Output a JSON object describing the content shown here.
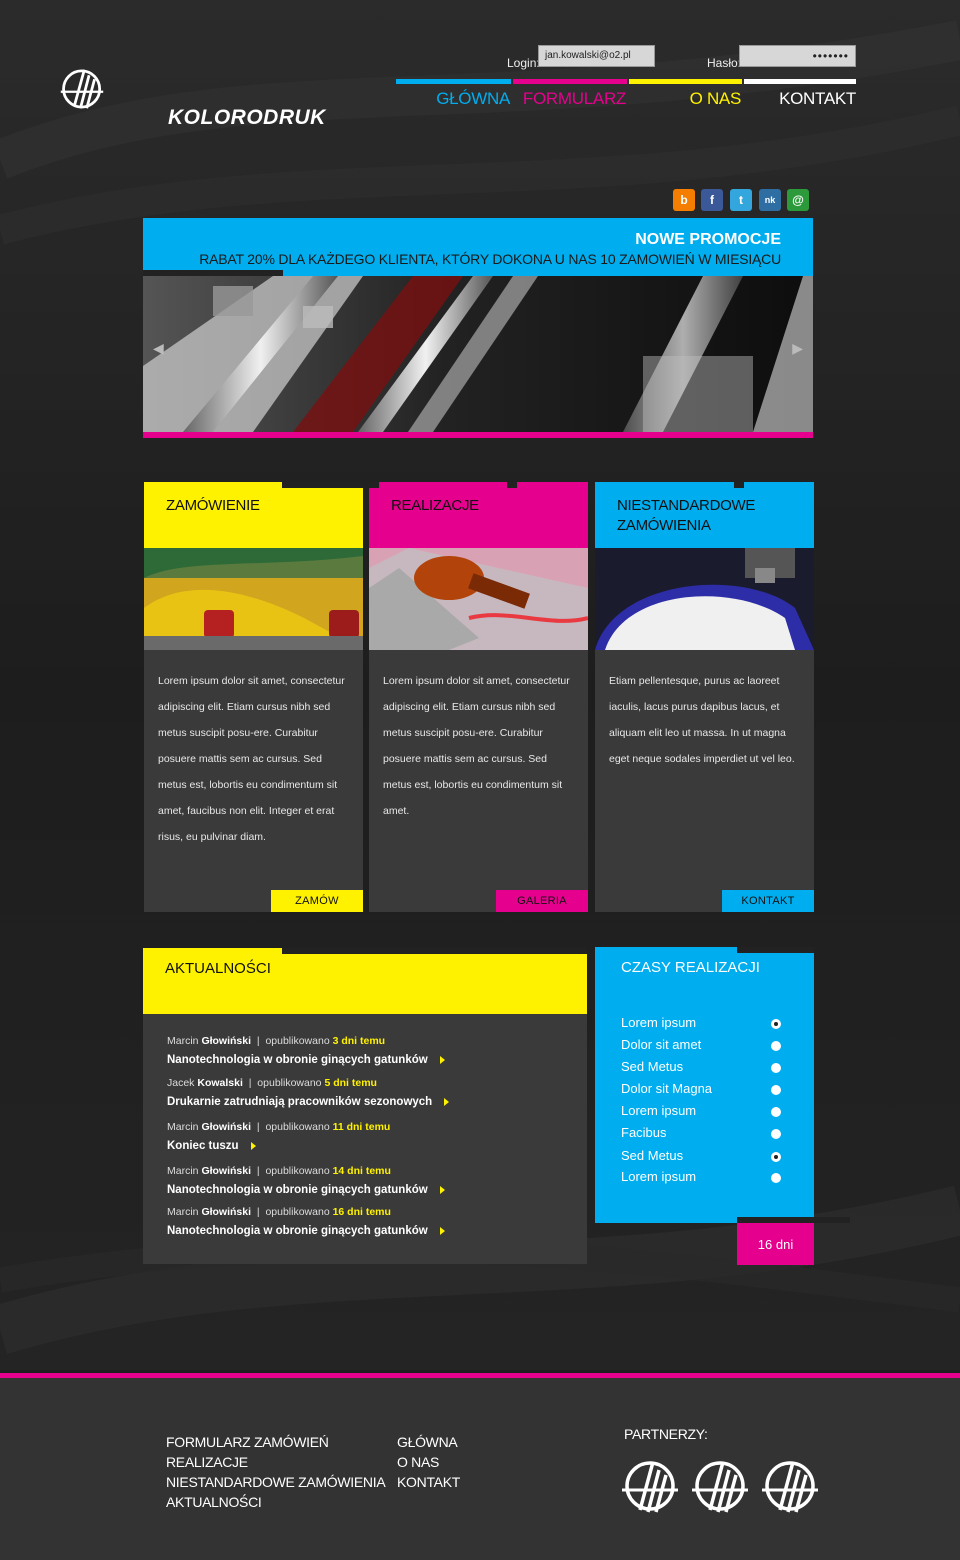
{
  "brand": {
    "name": "KOLORODRUK"
  },
  "login": {
    "login_label": "Login:",
    "login_value": "jan.kowalski@o2.pl",
    "password_label": "Hasło:",
    "password_value": "•••••••"
  },
  "nav": [
    {
      "label": "GŁÓWNA",
      "color": "#00adee"
    },
    {
      "label": "FORMULARZ",
      "color": "#e5008d"
    },
    {
      "label": "O NAS",
      "color": "#fff200"
    },
    {
      "label": "KONTAKT",
      "color": "#ffffff"
    }
  ],
  "social": [
    {
      "icon": "blogger-icon",
      "glyph": "b",
      "color": "#f57d00"
    },
    {
      "icon": "facebook-icon",
      "glyph": "f",
      "color": "#3b5998"
    },
    {
      "icon": "twitter-icon",
      "glyph": "t",
      "color": "#33a7dd"
    },
    {
      "icon": "nasza-klasa-icon",
      "glyph": "nk",
      "color": "#2f6ea3"
    },
    {
      "icon": "email-icon",
      "glyph": "@",
      "color": "#2c9a3a"
    }
  ],
  "promo": {
    "title": "NOWE PROMOCJE",
    "text": "RABAT 20% DLA KAŻDEGO KLIENTA, KTÓRY DOKONA U NAS 10 ZAMOWIEŃ W MIESIĄCU"
  },
  "cards": [
    {
      "title": "ZAMÓWIENIE",
      "color": "#fff200",
      "body": "Lorem ipsum dolor sit amet, consectetur adipiscing elit. Etiam cursus nibh sed metus suscipit posu-ere. Curabitur posuere mattis sem ac cursus. Sed metus est, lobortis eu condimentum sit amet, faucibus non elit. Integer et erat risus, eu pulvinar diam.",
      "button": "ZAMÓW"
    },
    {
      "title": "REALIZACJE",
      "color": "#e5008d",
      "body": "Lorem ipsum dolor sit amet, consectetur adipiscing elit. Etiam cursus nibh sed metus suscipit posu-ere. Curabitur posuere mattis sem ac cursus. Sed metus est, lobortis eu condimentum sit amet.",
      "button": "GALERIA"
    },
    {
      "title": "NIESTANDARDOWE ZAMÓWIENIA",
      "color": "#00adee",
      "body": "Etiam pellentesque, purus ac laoreet iaculis, lacus purus dapibus lacus, et aliquam elit leo ut massa. In ut magna eget neque sodales imperdiet ut vel leo.",
      "button": "KONTAKT"
    }
  ],
  "news": {
    "title": "AKTUALNOŚCI",
    "items": [
      {
        "first": "Marcin",
        "last": "Głowiński",
        "published": "opublikowano",
        "ago": "3 dni temu",
        "headline": "Nanotechnologia w obronie ginących gatunków"
      },
      {
        "first": "Jacek",
        "last": "Kowalski",
        "published": "opublikowano",
        "ago": "5 dni temu",
        "headline": "Drukarnie zatrudniają pracowników sezonowych"
      },
      {
        "first": "Marcin",
        "last": "Głowiński",
        "published": "opublikowano",
        "ago": "11 dni temu",
        "headline": "Koniec tuszu"
      },
      {
        "first": "Marcin",
        "last": "Głowiński",
        "published": "opublikowano",
        "ago": "14 dni temu",
        "headline": "Nanotechnologia w obronie ginących gatunków"
      },
      {
        "first": "Marcin",
        "last": "Głowiński",
        "published": "opublikowano",
        "ago": "16 dni temu",
        "headline": "Nanotechnologia w obronie ginących gatunków"
      }
    ]
  },
  "times": {
    "title": "CZASY REALIZACJI",
    "options": [
      {
        "label": "Lorem ipsum",
        "selected": true
      },
      {
        "label": "Dolor sit amet",
        "selected": false
      },
      {
        "label": "Sed Metus",
        "selected": false
      },
      {
        "label": "Dolor sit Magna",
        "selected": false
      },
      {
        "label": "Lorem ipsum",
        "selected": false
      },
      {
        "label": "Facibus",
        "selected": false
      },
      {
        "label": "Sed Metus",
        "selected": true
      },
      {
        "label": "Lorem ipsum",
        "selected": false
      }
    ],
    "result": "16 dni"
  },
  "footer": {
    "col1": [
      "FORMULARZ ZAMÓWIEŃ",
      "REALIZACJE",
      "NIESTANDARDOWE ZAMÓWIENIA",
      "AKTUALNOŚCI"
    ],
    "col2": [
      "GŁÓWNA",
      "O NAS",
      "KONTAKT"
    ],
    "partners_label": "PARTNERZY:"
  }
}
